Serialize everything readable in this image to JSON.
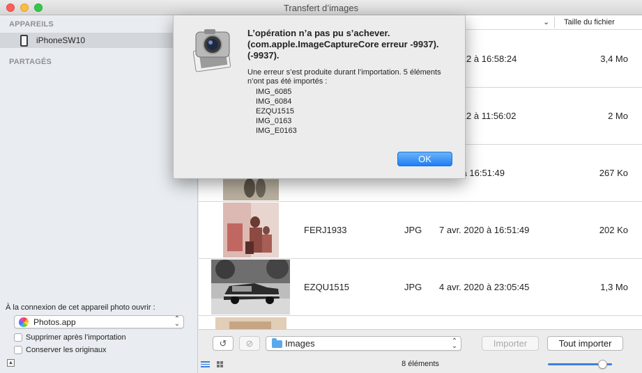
{
  "window": {
    "title": "Transfert d’images"
  },
  "sidebar": {
    "devices_header": "APPAREILS",
    "device_name": "iPhoneSW10",
    "shared_header": "PARTAGÉS",
    "open_label": "À la connexion de cet appareil photo ouvrir :",
    "open_app": "Photos.app",
    "delete_after_import": "Supprimer après l’importation",
    "keep_originals": "Conserver les originaux"
  },
  "table": {
    "size_header": "Taille du fichier",
    "rows": [
      {
        "name": "",
        "type": "",
        "date": "ct. 2022 à 16:58:24",
        "size": "3,4 Mo",
        "thumb": "none"
      },
      {
        "name": "",
        "type": "",
        "date": "ct. 2022 à 11:56:02",
        "size": "2 Mo",
        "thumb": "none"
      },
      {
        "name": "",
        "type": "",
        "date": "2020 à 16:51:49",
        "size": "267 Ko",
        "thumb": "sepia-group"
      },
      {
        "name": "FERJ1933",
        "type": "JPG",
        "date": "7 avr. 2020 à 16:51:49",
        "size": "202 Ko",
        "thumb": "red-faded-group"
      },
      {
        "name": "EZQU1515",
        "type": "JPG",
        "date": "4 avr. 2020 à 23:05:45",
        "size": "1,3 Mo",
        "thumb": "bw-car"
      }
    ]
  },
  "toolbar": {
    "folder": "Images",
    "import_label": "Importer",
    "import_all_label": "Tout importer",
    "count": "8 éléments",
    "thumbnail_size": 0.85
  },
  "dialog": {
    "title": "L’opération n’a pas pu s’achever. (com.apple.ImageCaptureCore erreur -9937). (-9937).",
    "message": "Une erreur s’est produite durant l’importation. 5 éléments n’ont pas été importés :",
    "files": [
      "IMG_6085",
      "IMG_6084",
      "EZQU1515",
      "IMG_0163",
      "IMG_E0163"
    ],
    "ok_label": "OK"
  },
  "icons": {
    "rotate": "rotate-icon",
    "delete": "delete-circle-icon",
    "folder": "folder-icon",
    "list_view": "list-view-icon",
    "grid_view": "grid-view-icon",
    "app": "image-capture-camera-icon"
  },
  "colors": {
    "accent": "#3d7fe0",
    "ok_button": "#1f7ef2",
    "selection": "#d3d6db"
  }
}
